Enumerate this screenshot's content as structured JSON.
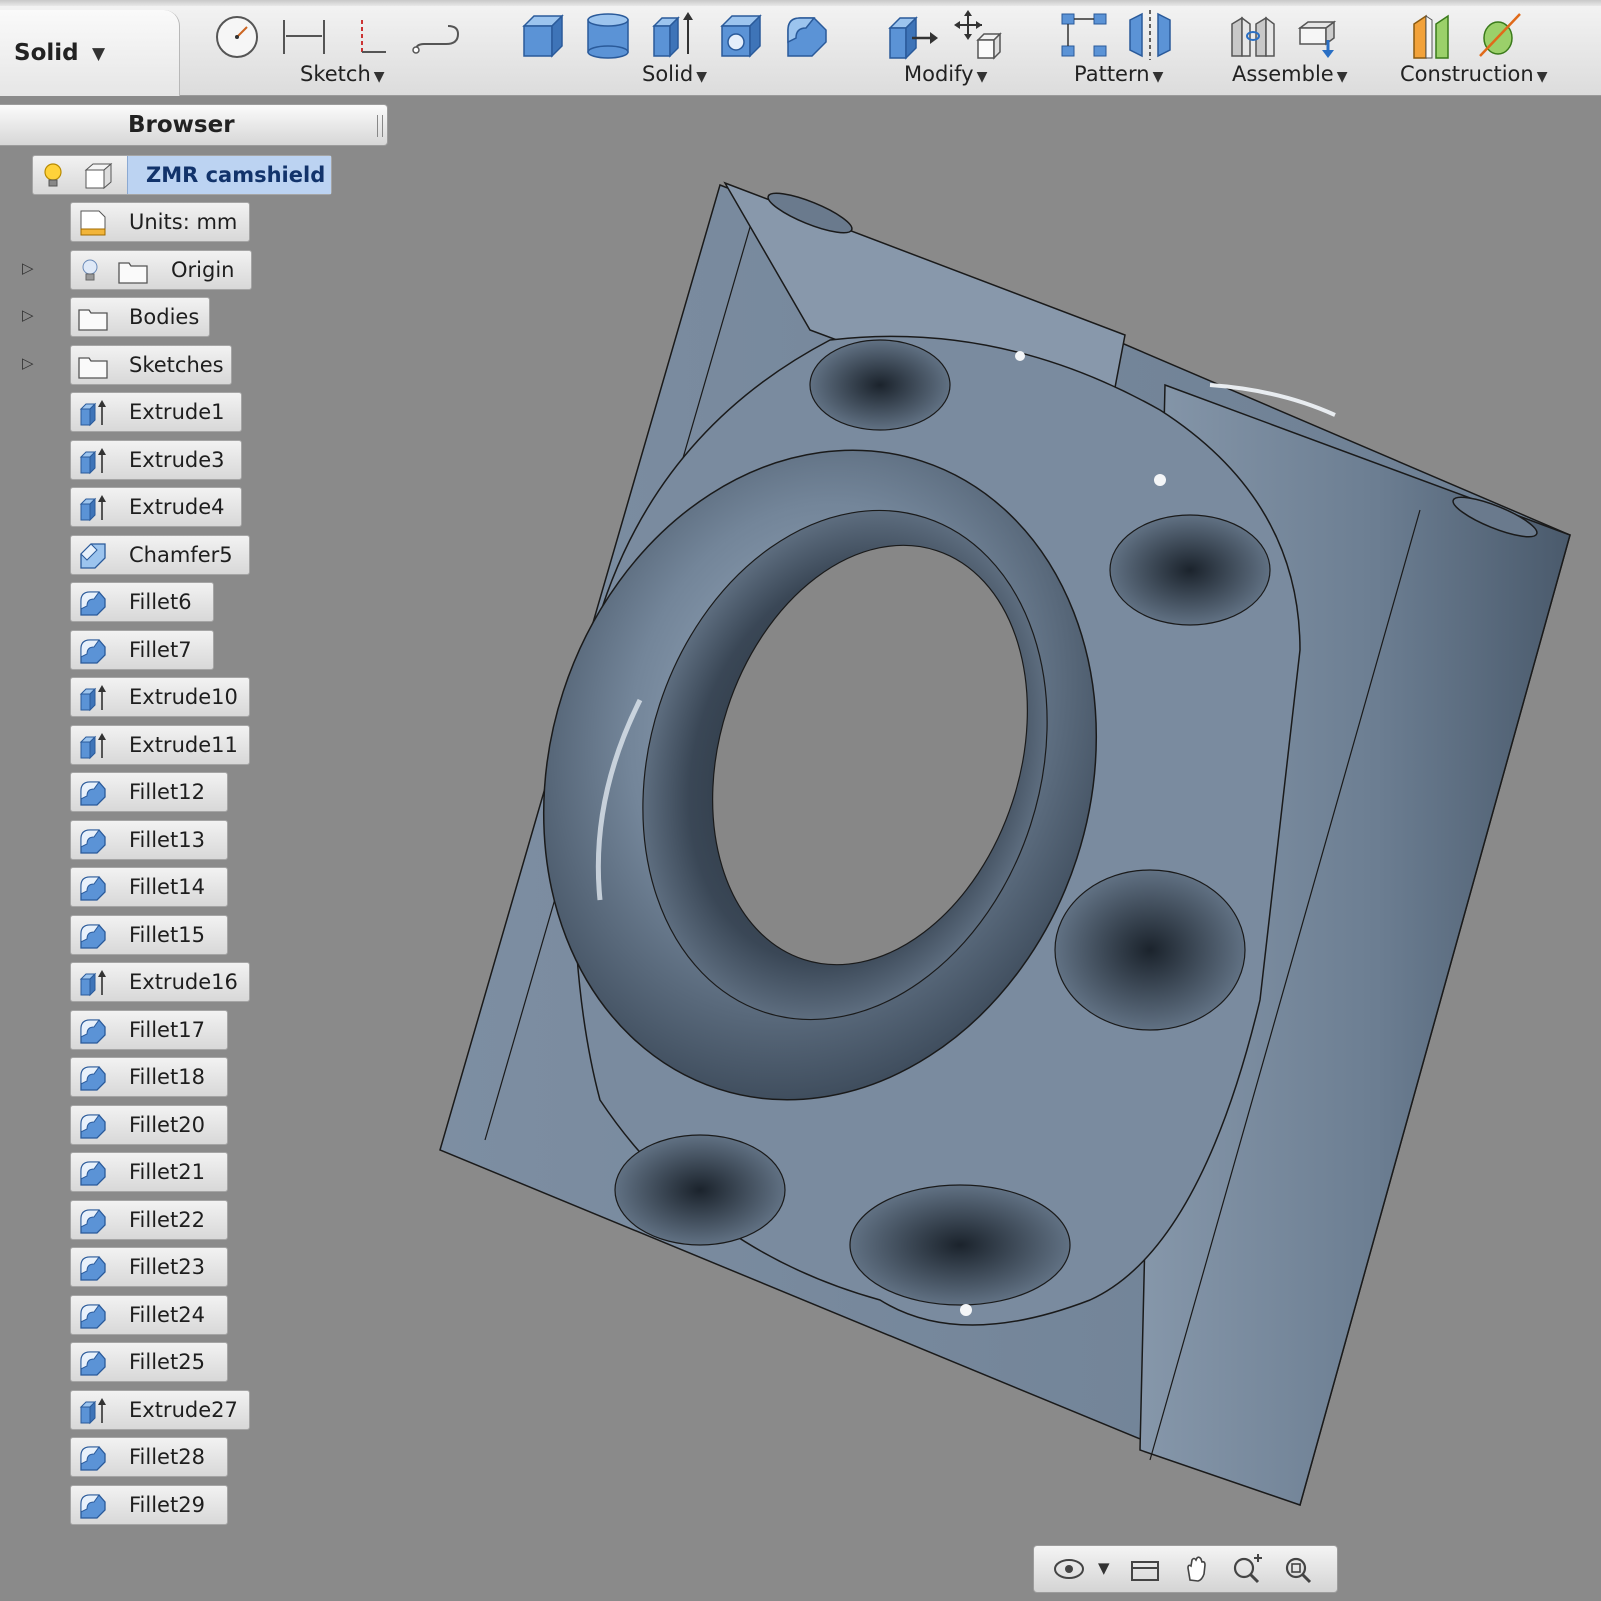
{
  "toolbar": {
    "workspace": "Solid",
    "groups": [
      {
        "label": "Sketch"
      },
      {
        "label": "Solid"
      },
      {
        "label": "Modify"
      },
      {
        "label": "Pattern"
      },
      {
        "label": "Assemble"
      },
      {
        "label": "Construction"
      }
    ]
  },
  "browser": {
    "title": "Browser",
    "root": "ZMR camshield",
    "items": [
      {
        "label": "Units: mm"
      },
      {
        "label": "Origin"
      },
      {
        "label": "Bodies"
      },
      {
        "label": "Sketches"
      },
      {
        "label": "Extrude1"
      },
      {
        "label": "Extrude3"
      },
      {
        "label": "Extrude4"
      },
      {
        "label": "Chamfer5"
      },
      {
        "label": "Fillet6"
      },
      {
        "label": "Fillet7"
      },
      {
        "label": "Extrude10"
      },
      {
        "label": "Extrude11"
      },
      {
        "label": "Fillet12"
      },
      {
        "label": "Fillet13"
      },
      {
        "label": "Fillet14"
      },
      {
        "label": "Fillet15"
      },
      {
        "label": "Extrude16"
      },
      {
        "label": "Fillet17"
      },
      {
        "label": "Fillet18"
      },
      {
        "label": "Fillet20"
      },
      {
        "label": "Fillet21"
      },
      {
        "label": "Fillet22"
      },
      {
        "label": "Fillet23"
      },
      {
        "label": "Fillet24"
      },
      {
        "label": "Fillet25"
      },
      {
        "label": "Extrude27"
      },
      {
        "label": "Fillet28"
      },
      {
        "label": "Fillet29"
      }
    ]
  },
  "colors": {
    "accent": "#bcd3f2",
    "model": "#6f8398",
    "viewport_bg": "#8a8a8a"
  }
}
